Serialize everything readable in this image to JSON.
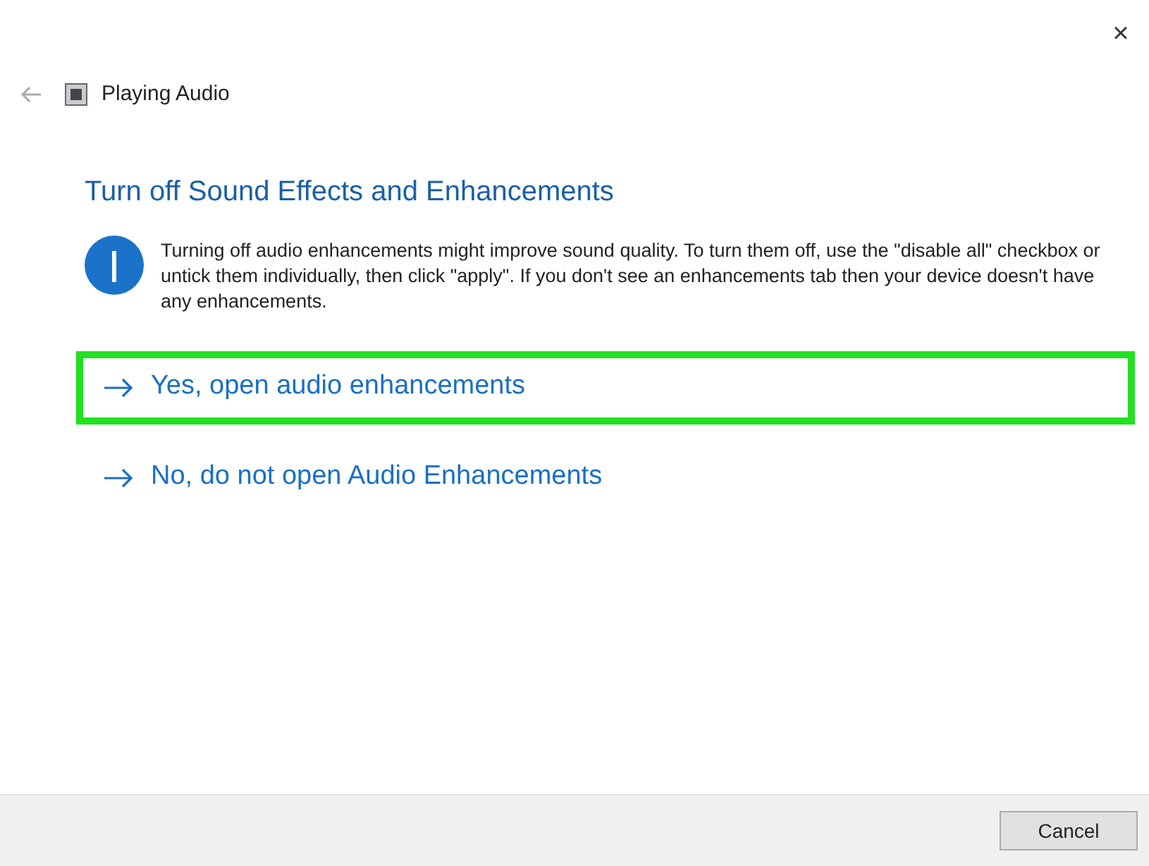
{
  "window": {
    "title": "Playing Audio",
    "close": "×"
  },
  "heading": "Turn off Sound Effects and Enhancements",
  "info": {
    "text": "Turning off audio enhancements might improve sound quality. To turn them off, use the \"disable all\" checkbox or untick them individually, then click \"apply\". If you don't see an enhancements tab then your device doesn't have any enhancements."
  },
  "options": [
    {
      "label": "Yes, open audio enhancements",
      "highlighted": true
    },
    {
      "label": "No, do not open Audio Enhancements",
      "highlighted": false
    }
  ],
  "footer": {
    "buttons": [
      "Cancel"
    ]
  }
}
